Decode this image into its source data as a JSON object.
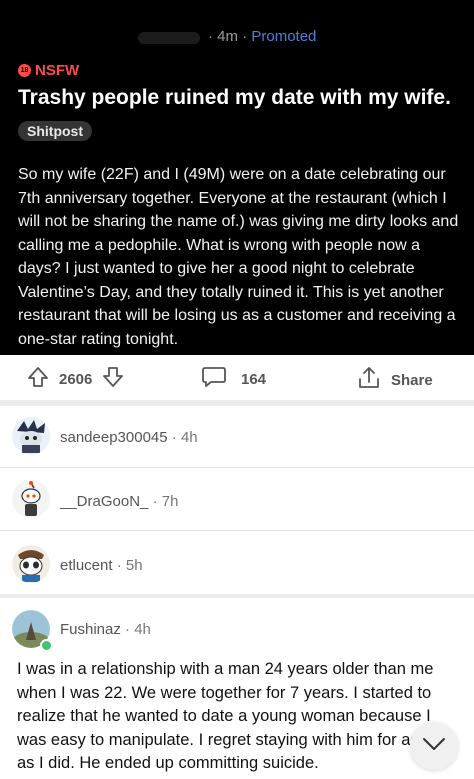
{
  "post": {
    "time": "4m",
    "separator": "·",
    "promoted": "Promoted",
    "nsfw_label": "NSFW",
    "nsfw_badge": "18",
    "title": "Trashy people ruined my date with my wife.",
    "flair": "Shitpost",
    "body": "So my wife (22F) and I (49M) were on a date celebrating our 7th anniversary together. Everyone at the restaurant (which I will not be sharing the name of.) was giving me dirty looks and calling me a pedophile. What is wrong with people now a days? I just wanted to give her a good night to celebrate Valentine’s Day, and they totally ruined it. This is yet another restaurant that will be losing us as a customer and receiving a one-star rating tonight."
  },
  "actions": {
    "upvotes": "2606",
    "comments": "164",
    "share": "Share"
  },
  "comments": [
    {
      "user": "sandeep300045",
      "time": "4h"
    },
    {
      "user": "__DraGooN_",
      "time": "7h"
    },
    {
      "user": "etlucent",
      "time": "5h"
    },
    {
      "user": "Fushinaz",
      "time": "4h",
      "text": "I was in a relationship with a man 24 years older than me when I was 22. We were together for 7 years. I started to realize that he wanted to date a young woman because I was easy to manipulate. I regret staying with him for as long as I did. He ended up committing suicide."
    }
  ],
  "colors": {
    "nsfw": "#ff4a4a",
    "promoted": "#4f7fd6",
    "online": "#3ec46d"
  }
}
